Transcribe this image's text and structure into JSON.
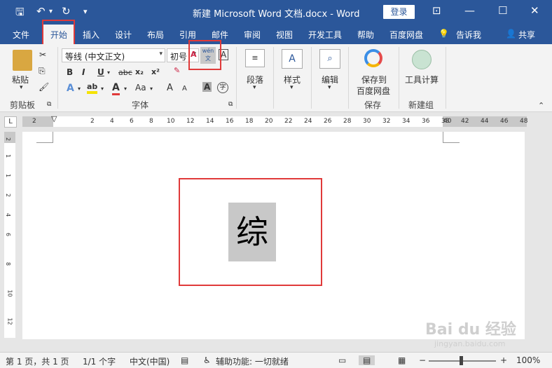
{
  "titlebar": {
    "title": "新建 Microsoft Word 文档.docx  -  Word",
    "login_label": "登录",
    "save_glyph": "🖫",
    "undo_glyph": "↶",
    "redo_glyph": "↻",
    "customize_glyph": "▾",
    "restore_glyph": "⊡",
    "minimize_glyph": "—",
    "maximize_glyph": "☐",
    "close_glyph": "✕"
  },
  "tabs": [
    {
      "label": "文件"
    },
    {
      "label": "开始"
    },
    {
      "label": "插入"
    },
    {
      "label": "设计"
    },
    {
      "label": "布局"
    },
    {
      "label": "引用"
    },
    {
      "label": "邮件"
    },
    {
      "label": "审阅"
    },
    {
      "label": "视图"
    },
    {
      "label": "开发工具"
    },
    {
      "label": "帮助"
    },
    {
      "label": "百度网盘"
    },
    {
      "label": "告诉我"
    },
    {
      "label": "共享"
    }
  ],
  "ribbon": {
    "clipboard": {
      "paste_label": "粘贴",
      "group_label": "剪贴板"
    },
    "font": {
      "font_name": "等线 (中文正文)",
      "font_size": "初号",
      "group_label": "字体",
      "bold": "B",
      "italic": "I",
      "underline": "U",
      "strike": "abc",
      "subscript": "x₂",
      "superscript": "x²",
      "grow": "A",
      "shrink": "A",
      "clear": "A",
      "phonetic": "wén 文",
      "charborder": "A",
      "case": "Aa",
      "charshading": "A",
      "encircle": "字"
    },
    "paragraph": {
      "label": "段落"
    },
    "styles": {
      "label": "样式"
    },
    "editing": {
      "label": "编辑"
    },
    "save_cloud": {
      "line1": "保存到",
      "line2": "百度网盘",
      "group_label": "保存"
    },
    "newgroup": {
      "button_label": "工具计算",
      "group_label": "新建组"
    }
  },
  "ruler": {
    "corner": "L",
    "left_ticks": [
      "2"
    ],
    "ticks": [
      "2",
      "4",
      "6",
      "8",
      "10",
      "12",
      "14",
      "16",
      "18",
      "20",
      "22",
      "24",
      "26",
      "28",
      "30",
      "32",
      "34",
      "36",
      "38"
    ],
    "right_ticks": [
      "40",
      "42",
      "44",
      "46",
      "48"
    ],
    "v_ticks": [
      "2",
      "1",
      "1",
      "2",
      "4",
      "6",
      "8",
      "10",
      "12"
    ]
  },
  "document": {
    "character": "综"
  },
  "status": {
    "page": "第 1 页，共 1 页",
    "words": "1/1 个字",
    "language": "中文(中国)",
    "accessibility": "辅助功能: 一切就绪",
    "zoom": "100%",
    "zoom_minus": "−",
    "zoom_plus": "+"
  },
  "watermark": {
    "brand": "Bai du 经验",
    "url": "jingyan.baidu.com"
  },
  "colors": {
    "title_blue": "#2b579a",
    "highlight_red": "#e03a3a",
    "char_shading": "#c8c8c8"
  }
}
